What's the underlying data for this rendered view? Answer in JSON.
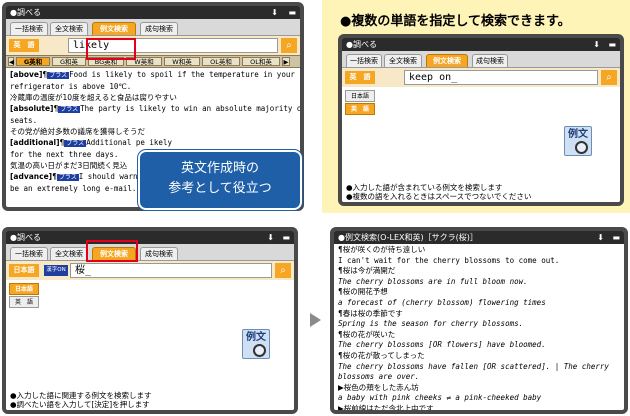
{
  "panel1": {
    "title": "●調べる",
    "tabs": [
      "一括検索",
      "全文検索",
      "例文検索",
      "成句検索"
    ],
    "dict": "英　語",
    "input": "likely",
    "subtabs": [
      "G英和",
      "G和英",
      "BG英和",
      "W英和",
      "W和英",
      "OL英和",
      "OL和英"
    ],
    "lines": [
      {
        "key": "[above]",
        "mark": "¶",
        "plus": "プラス",
        "text": "Food is likely to spoil if the temperature in your"
      },
      {
        "text": "refrigerator is above 10℃."
      },
      {
        "text": "冷蔵庫の温度が10度を超えると食品は腐りやすい"
      },
      {
        "key": "[absolute]",
        "mark": "¶",
        "plus": "プラス",
        "text": "The party is likely to win an absolute majority of"
      },
      {
        "text": "seats."
      },
      {
        "text": "その党が絶対多数の議席を獲得しそうだ"
      },
      {
        "key": "[additional]",
        "mark": "¶",
        "plus": "プラス",
        "text": "Additional pe                                    ikely"
      },
      {
        "text": "for the next three days."
      },
      {
        "text": "気温の高い日がまだ3日間続く見込"
      },
      {
        "key": "[advance]",
        "mark": "¶",
        "plus": "プラス",
        "text": "I should warn                                   ill"
      },
      {
        "text": "be an extremely long e-mail."
      }
    ],
    "note": [
      "英文作成時の",
      "参考として役立つ"
    ]
  },
  "panel2": {
    "caption": "●複数の単語を指定して検索できます。",
    "title": "●調べる",
    "tabs": [
      "一括検索",
      "全文検索",
      "例文検索",
      "成句検索"
    ],
    "dict": "英　語",
    "input": "keep on_",
    "side": [
      "日本語",
      "英　語"
    ],
    "icon": "例文",
    "footer": [
      "●入力した語が含まれている例文を検索します",
      "●複数の語を入れるときはスペースでつないでください"
    ]
  },
  "panel3": {
    "title": "●調べる",
    "tabs": [
      "一括検索",
      "全文検索",
      "例文検索",
      "成句検索"
    ],
    "dict": "日本語",
    "badge": "漢字ON",
    "input": "桜_",
    "side": [
      "日本語",
      "英　語"
    ],
    "icon": "例文",
    "footer": [
      "●入力した語に関連する例文を検索します",
      "●調べたい語を入力して[決定]を押します"
    ]
  },
  "panel4": {
    "title": "●例文検索(O-LEX和英)［サクラ(桜)］",
    "lines": [
      {
        "t": "¶桜が咲くのが待ち遠しい",
        "s": "j"
      },
      {
        "t": "I can't wait for the cherry blossoms to come out.",
        "s": "m"
      },
      {
        "t": "¶桜は今が満開だ",
        "s": "j"
      },
      {
        "t": "The cherry blossoms are in full bloom now.",
        "s": "mi"
      },
      {
        "t": "¶桜の開花予想",
        "s": "j"
      },
      {
        "t": "a forecast of (cherry blossom) flowering times",
        "s": "mi"
      },
      {
        "t": "¶春は桜の季節です",
        "s": "j"
      },
      {
        "t": "Spring is the season for cherry blossoms.",
        "s": "mi"
      },
      {
        "t": "¶桜の花が咲いた",
        "s": "j"
      },
      {
        "t": "The cherry blossoms [OR flowers] have bloomed.",
        "s": "mi"
      },
      {
        "t": "¶桜の花が散ってしまった",
        "s": "j"
      },
      {
        "t": "The cherry blossoms have fallen [OR scattered]. | The cherry",
        "s": "mi"
      },
      {
        "t": "blossoms are over.",
        "s": "mi"
      },
      {
        "t": "▶桜色の頬をした赤ん坊",
        "s": "j"
      },
      {
        "t": "a baby with pink cheeks ⇌ a pink-cheeked baby",
        "s": "mi"
      },
      {
        "t": "▶桜前線はただ今北上中です",
        "s": "j"
      }
    ]
  },
  "colors": {
    "accent": "#f5a623",
    "highlight": "#e2001a",
    "note_bg": "#1f5fa8",
    "caption_bg": "#fff4b8"
  }
}
